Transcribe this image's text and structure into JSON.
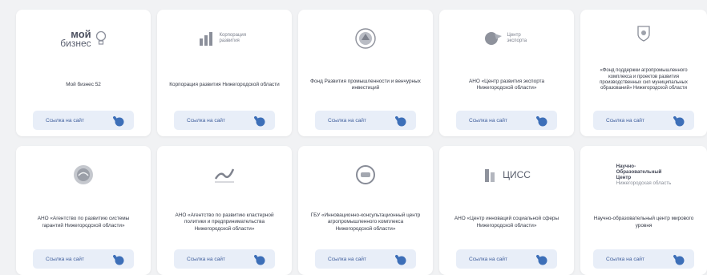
{
  "button_label": "Ссылка на сайт",
  "cards": [
    {
      "logo": {
        "name": "moy-biznes-logo",
        "line1": "мой",
        "line2": "бизнес"
      },
      "title": "Мой бизнес 52"
    },
    {
      "logo": {
        "name": "corporation-logo",
        "text": "Корпорация развития"
      },
      "title": "Корпорация развития Нижегородской области"
    },
    {
      "logo": {
        "name": "fund-emblem-logo"
      },
      "title": "Фонд Развития промышленности и венчурных инвестиций"
    },
    {
      "logo": {
        "name": "export-center-logo",
        "text": "Центр экспорта"
      },
      "title": "АНО «Центр развития экспорта Нижегородской области»"
    },
    {
      "logo": {
        "name": "coat-of-arms-logo"
      },
      "title": "«Фонд поддержки агропромышленного комплекса и проектов развития производственных сил муниципальных образований» Нижегородской области"
    },
    {
      "logo": {
        "name": "guarantee-agency-logo"
      },
      "title": "АНО «Агентство по развитию системы гарантий Нижегородской области»"
    },
    {
      "logo": {
        "name": "cluster-agency-logo"
      },
      "title": "АНО «Агентство по развитию кластерной политики и предпринимательства Нижегородской области»"
    },
    {
      "logo": {
        "name": "agro-consulting-logo"
      },
      "title": "ГБУ «Инновационно-консультационный центр агропромышленного комплекса Нижегородской области»"
    },
    {
      "logo": {
        "name": "cissc-logo",
        "text": "ЦИСС"
      },
      "title": "АНО «Центр инноваций социальной сферы Нижегородской области»"
    },
    {
      "logo": {
        "name": "science-center-logo",
        "line1": "Научно-",
        "line2": "Образовательный",
        "line3": "Центр",
        "line4": "Нижегородская область"
      },
      "title": "Научно-образовательный центр мирового уровня"
    }
  ]
}
